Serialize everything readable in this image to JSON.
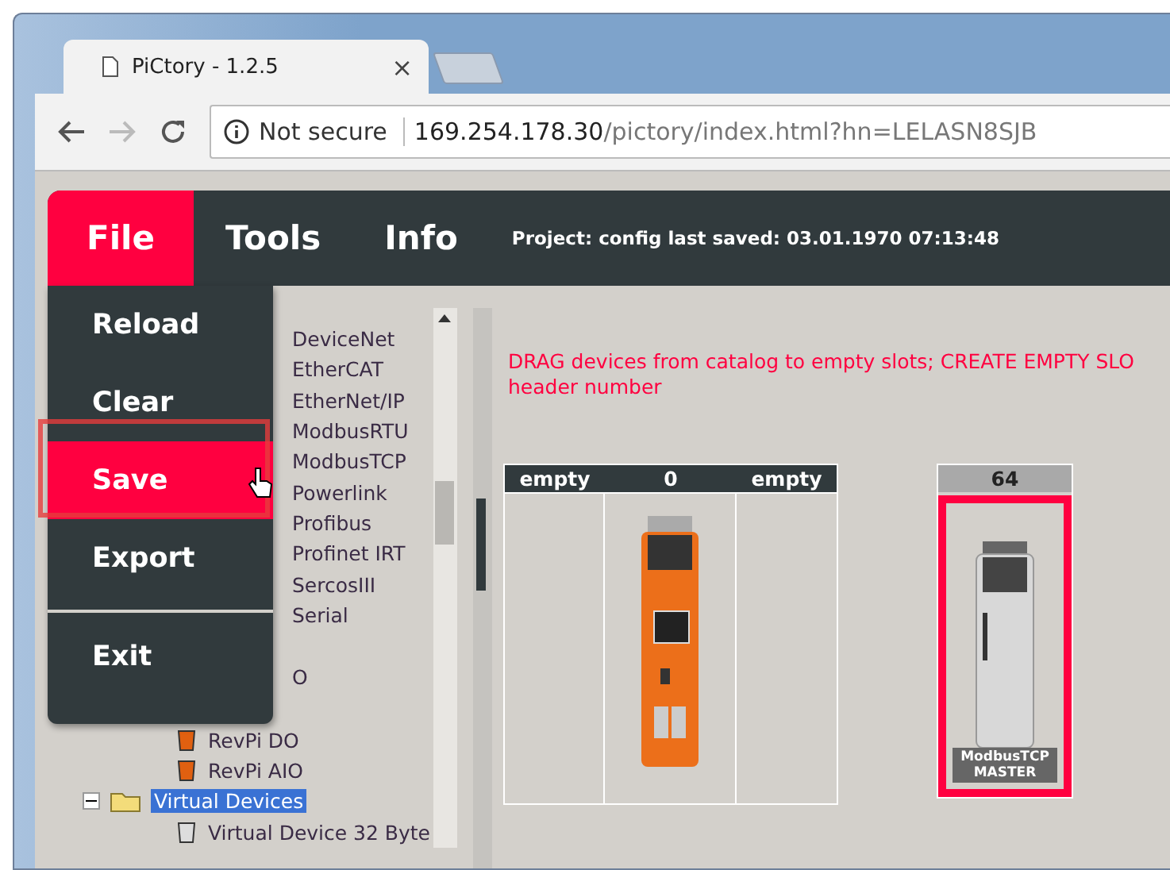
{
  "browser": {
    "tab_title": "PiCtory - 1.2.5",
    "tab_close": "×",
    "security": "Not secure",
    "url_host": "169.254.178.30",
    "url_path": "/pictory/index.html?hn=LELASN8SJB"
  },
  "menu_bar": {
    "items": [
      {
        "label": "File",
        "selected": true
      },
      {
        "label": "Tools",
        "selected": false
      },
      {
        "label": "Info",
        "selected": false
      }
    ],
    "project": "Project: config last saved: 03.01.1970 07:13:48"
  },
  "file_menu": {
    "items": [
      {
        "label": "Reload",
        "selected": false,
        "separator_before": false
      },
      {
        "label": "Clear",
        "selected": false,
        "separator_before": false
      },
      {
        "label": "Save",
        "selected": true,
        "separator_before": false
      },
      {
        "label": "Export",
        "selected": false,
        "separator_before": false
      },
      {
        "label": "Exit",
        "selected": false,
        "separator_before": true
      }
    ]
  },
  "catalog": {
    "items": [
      {
        "kind": "leaf",
        "label": "DeviceNet"
      },
      {
        "kind": "leaf",
        "label": "EtherCAT"
      },
      {
        "kind": "leaf",
        "label": "EtherNet/IP"
      },
      {
        "kind": "leaf",
        "label": "ModbusRTU"
      },
      {
        "kind": "leaf",
        "label": "ModbusTCP"
      },
      {
        "kind": "leaf",
        "label": "Powerlink"
      },
      {
        "kind": "leaf",
        "label": "Profibus"
      },
      {
        "kind": "leaf",
        "label": "Profinet IRT"
      },
      {
        "kind": "leaf",
        "label": "SercosIII"
      },
      {
        "kind": "leaf",
        "label": "Serial"
      },
      {
        "kind": "partial",
        "label": "O"
      },
      {
        "kind": "device",
        "label": "RevPi DO"
      },
      {
        "kind": "device",
        "label": "RevPi AIO"
      },
      {
        "kind": "folder",
        "label": "Virtual Devices",
        "expanded": true,
        "selected": true,
        "children": [
          {
            "kind": "virtual",
            "label": "Virtual Device 32 Byte"
          }
        ]
      }
    ]
  },
  "workspace": {
    "instructions": [
      "DRAG devices from catalog to empty slots; CREATE EMPTY SLO",
      "header number"
    ],
    "base_slots": [
      {
        "label": "empty",
        "device": false
      },
      {
        "label": "0",
        "device": true
      },
      {
        "label": "empty",
        "device": false
      }
    ],
    "extra_slot": {
      "label": "64",
      "device_label": "ModbusTCP MASTER",
      "selected": true
    }
  }
}
